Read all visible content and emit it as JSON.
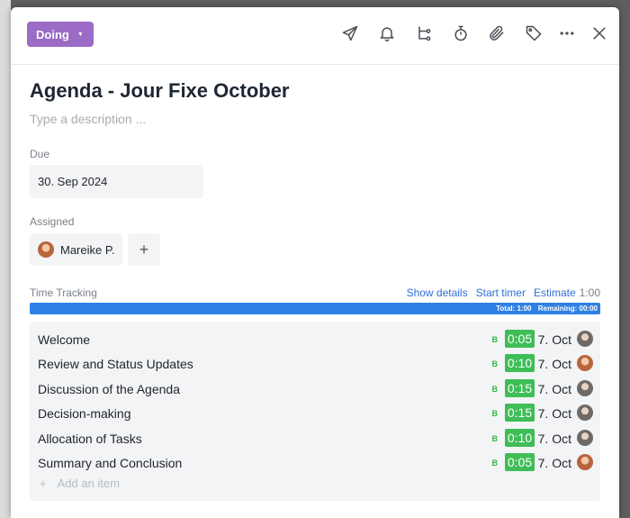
{
  "status": {
    "label": "Doing"
  },
  "task": {
    "title": "Agenda - Jour Fixe October",
    "description_placeholder": "Type a description ..."
  },
  "due": {
    "label": "Due",
    "value": "30. Sep 2024"
  },
  "assigned": {
    "label": "Assigned",
    "name": "Mareike P.",
    "add": "+"
  },
  "time_tracking": {
    "label": "Time Tracking",
    "show_details": "Show details",
    "start_timer": "Start timer",
    "estimate": "Estimate",
    "estimate_value": "1:00",
    "total": "Total: 1:00",
    "remaining": "Remaining: 00:00",
    "progress_fraction": 1.0,
    "bar_color": "#2f80e4"
  },
  "checklist": {
    "items": [
      {
        "name": "Welcome",
        "tag": "B",
        "time": "0:05",
        "date": "7. Oct",
        "avatar": "male"
      },
      {
        "name": "Review and Status Updates",
        "tag": "B",
        "time": "0:10",
        "date": "7. Oct",
        "avatar": "female"
      },
      {
        "name": "Discussion of the Agenda",
        "tag": "B",
        "time": "0:15",
        "date": "7. Oct",
        "avatar": "male"
      },
      {
        "name": "Decision-making",
        "tag": "B",
        "time": "0:15",
        "date": "7. Oct",
        "avatar": "male"
      },
      {
        "name": "Allocation of Tasks",
        "tag": "B",
        "time": "0:10",
        "date": "7. Oct",
        "avatar": "male"
      },
      {
        "name": "Summary and Conclusion",
        "tag": "B",
        "time": "0:05",
        "date": "7. Oct",
        "avatar": "female"
      }
    ],
    "add_icon": "+",
    "add_placeholder": "Add an item"
  },
  "colors": {
    "status": "#9b6bc5",
    "time_badge": "#3fbd57",
    "link": "#2f6fd6"
  },
  "icons": [
    "send-icon",
    "bell-icon",
    "subtask-icon",
    "stopwatch-icon",
    "paperclip-icon",
    "tag-icon",
    "more-icon",
    "close-icon"
  ]
}
